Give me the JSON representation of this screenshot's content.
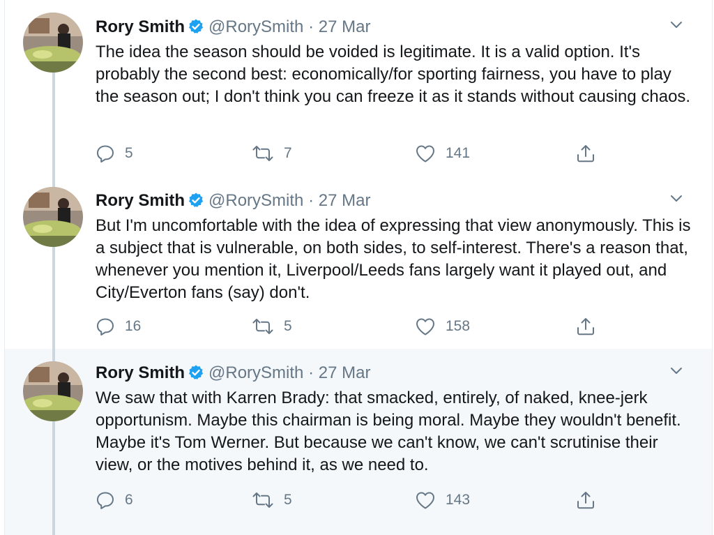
{
  "tweets": [
    {
      "name": "Rory Smith",
      "handle": "@RorySmith",
      "separator": "·",
      "date": "27 Mar",
      "text": "The idea the season should be voided is legitimate. It is a valid option. It's probably the second best: economically/for sporting fairness, you have to play the season out; I don't think you can freeze it as it stands without causing chaos.",
      "replies": "5",
      "retweets": "7",
      "likes": "141"
    },
    {
      "name": "Rory Smith",
      "handle": "@RorySmith",
      "separator": "·",
      "date": "27 Mar",
      "text": "But I'm uncomfortable with the idea of expressing that view anonymously. This is a subject that is vulnerable, on both sides, to self-interest. There's a reason that, whenever you mention it, Liverpool/Leeds fans largely want it played out, and City/Everton fans (say) don't.",
      "replies": "16",
      "retweets": "5",
      "likes": "158"
    },
    {
      "name": "Rory Smith",
      "handle": "@RorySmith",
      "separator": "·",
      "date": "27 Mar",
      "text": "We saw that with Karren Brady: that smacked, entirely, of naked, knee-jerk opportunism. Maybe this chairman is being moral. Maybe they wouldn't benefit. Maybe it's Tom Werner. But because we can't know, we can't scrutinise their view, or the motives behind it, as we need to.",
      "replies": "6",
      "retweets": "5",
      "likes": "143"
    }
  ],
  "colors": {
    "verified": "#1da1f2",
    "secondary_text": "#657786",
    "thread_line": "#ccd6dd",
    "highlight_bg": "#f5f8fa"
  },
  "icons": {
    "verified": "verified-badge-icon",
    "caret": "chevron-down-icon",
    "reply": "reply-icon",
    "retweet": "retweet-icon",
    "like": "heart-icon",
    "share": "share-icon"
  }
}
